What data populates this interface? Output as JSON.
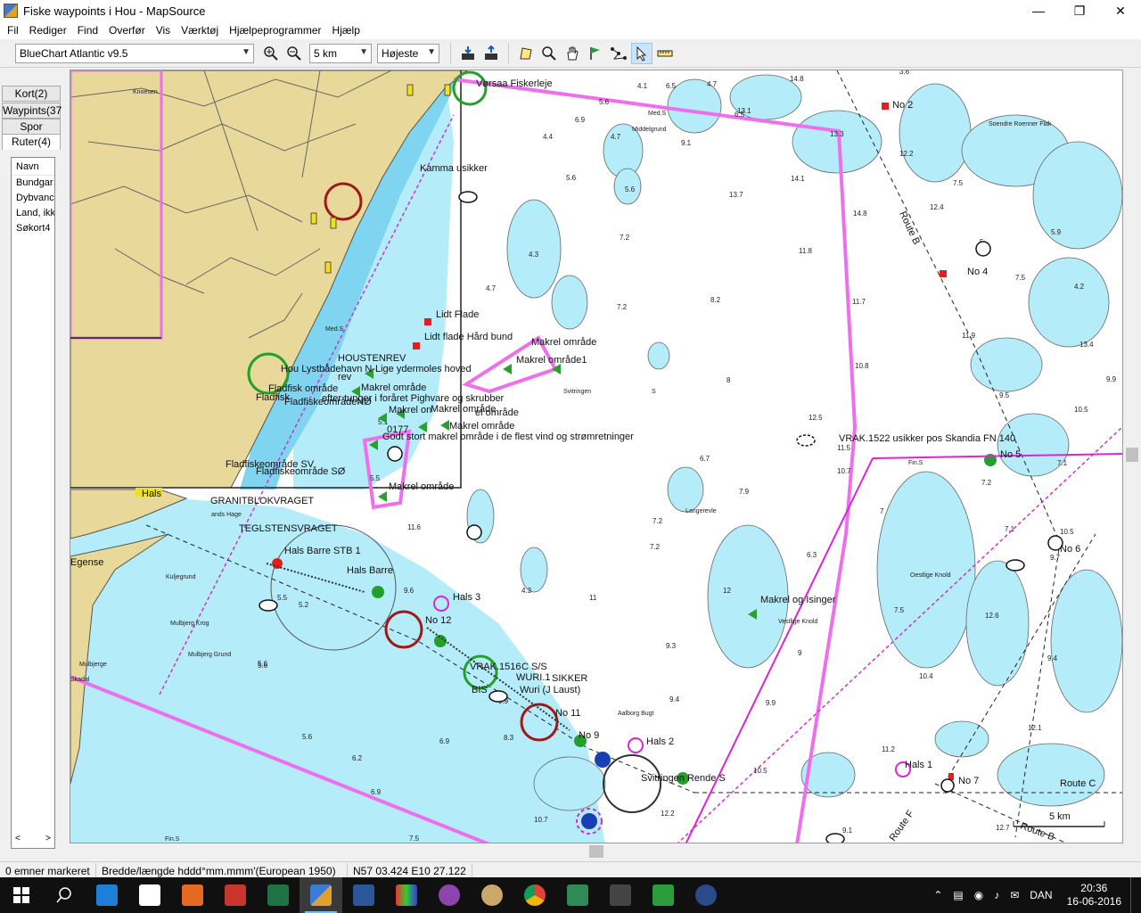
{
  "window": {
    "title": "Fiske waypoints i Hou - MapSource"
  },
  "menu": [
    "Fil",
    "Rediger",
    "Find",
    "Overfør",
    "Vis",
    "Værktøj",
    "Hjælpeprogrammer",
    "Hjælp"
  ],
  "toolbar": {
    "map_product": "BlueChart Atlantic v9.5",
    "zoom_value": "5 km",
    "detail_value": "Højeste"
  },
  "tabs": [
    "Kort(2)",
    "Waypints(37",
    "Spor",
    "Ruter(4)"
  ],
  "routes_list": {
    "header": "Navn",
    "items": [
      "Bundgar",
      "Dybvanc",
      "Land, ikk",
      "Søkort4"
    ]
  },
  "map": {
    "labels": {
      "voersaa": "Vørsaa Fiskerleje",
      "kamma": "Kamma usikker",
      "no2": "No 2",
      "no4": "No 4",
      "no5": "No 5",
      "no6": "No 6",
      "no7": "No 7",
      "no11": "No 11",
      "no12": "No 12",
      "no9": "No 9",
      "route_b": "Route B",
      "route_b2": "Route B",
      "route_c": "Route C",
      "route_f": "Route F",
      "lidt_flade": "Lidt Flade",
      "lidt_flade_haard": "Lidt flade Hård bund",
      "makrel1": "Makrel område",
      "makrel2": "Makrel område1",
      "makrel3": "Makrel område",
      "makrel4": "Makrel område",
      "makrel5": "Makrel område",
      "makrel6": "Makrel område",
      "makrel7": "Makrel område",
      "makrel_on": "Makrel on",
      "makrel_isinger": "Makrel og Isinger",
      "houstenrev": "HOUSTENREV",
      "hou_lyst": "Hou Lystbådehavn N-Lige ydermoles hoved",
      "rev": "rev",
      "fladfisk": "Fladfisk område",
      "fladfisk_short": "Fladfisk",
      "fladfisk_no": "FladfiskeområdeNØ",
      "fladfisk_sv": "Fladfiskeområde SV",
      "fladfisk_so": "Fladfiskeområde SØ",
      "efter_tunger": "efter tunger i foråret Pighvare og skrubber",
      "ost_0177": "0177",
      "godt_stort": "Godt stort makrel område i de flest vind og strømretninger",
      "el_omraade": "el område",
      "hals": "Hals",
      "granit": "GRANITBLOKVRAGET",
      "tegl": "TEGLSTENSVRAGET",
      "hals_barre_stb": "Hals Barre STB 1",
      "hals_barre": "Hals Barre",
      "hals3": "Hals 3",
      "hals2": "Hals 2",
      "hals1": "Hals 1",
      "vrak1516": "VRAK.1516",
      "cs": "C S/S",
      "wuri": "WURI.1",
      "sikker": "SIKKER",
      "wuri_laust": "Wuri (J Laust)",
      "bis": "BIS",
      "vrak1522": "VRAK.1522 usikker pos Skandia FN 140",
      "svitringen_rende": "Svitringen Rende S",
      "egense": "Egense",
      "scale": "5 km",
      "knoesen": "Knoesen",
      "soendre": "Soendre Roenner Flak",
      "middelgrund": "Middelgrund",
      "meds": "Med.S",
      "meds2": "Med.S",
      "svitringen": "Svitringen",
      "langerevle": "Langerevle",
      "oestlige": "Oestlige Knold",
      "vestlige": "Vestlige Knold",
      "kuljegrund": "Kuljegrund",
      "mulbjerg_krog": "Mulbjerg Krog",
      "mulbjerg_grund": "Mulbjerg Grund",
      "mulbjerge": "Mulbjerge",
      "aalborg": "Aalborg Bugt",
      "lands_hage": "ands Hage",
      "fins": "Fin.S",
      "fins2": "Fin.S",
      "skadal": "Skadal",
      "s": "S"
    },
    "depths": [
      "4.1",
      "6.5",
      "4.7",
      "14.8",
      "3.6",
      "5.6",
      "6.9",
      "4.4",
      "4.7",
      "6.5",
      "13.1",
      "13.3",
      "12.2",
      "9.1",
      "14.1",
      "7.5",
      "12.4",
      "13.7",
      "5.6",
      "5.6",
      "5.9",
      "7.2",
      "4.3",
      "11.8",
      "14.8",
      "5",
      "7.5",
      "4.2",
      "4.7",
      "7.2",
      "8.2",
      "11.7",
      "11.9",
      "13.4",
      "10.8",
      "9.9",
      "8",
      "9.5",
      "10.5",
      "12.5",
      "6.7",
      "7.9",
      "7.2",
      "10.7",
      "11.5",
      "7.2",
      "7",
      "7.2",
      "6.3",
      "10.5",
      "7.1",
      "7.5",
      "12",
      "12.6",
      "9.3",
      "9",
      "11",
      "9.4",
      "10.4",
      "9.9",
      "12.1",
      "11.2",
      "10.5",
      "9.9",
      "8.3",
      "6.9",
      "6.2",
      "5.6",
      "6.9",
      "12.2",
      "10.7",
      "7.5",
      "12.7",
      "9.1",
      "9.7",
      "9.4",
      "5.5",
      "5.2",
      "5.6",
      "5.6",
      "11.6",
      "9.6",
      "5.5",
      "4.3",
      "5.1",
      "7.1"
    ],
    "colors": {
      "land": "#e8d89a",
      "shallow": "#7fd4f0",
      "mid": "#b4ecfa",
      "deep": "#ffffff",
      "route": "#ee6eee"
    }
  },
  "status": {
    "selected": "0 emner markeret",
    "coords_format": "Bredde/længde hddd°mm.mmm'(European 1950)",
    "position": "N57 03.424 E10 27.122"
  },
  "taskbar": {
    "language": "DAN",
    "time": "20:36",
    "date": "16-06-2016"
  }
}
